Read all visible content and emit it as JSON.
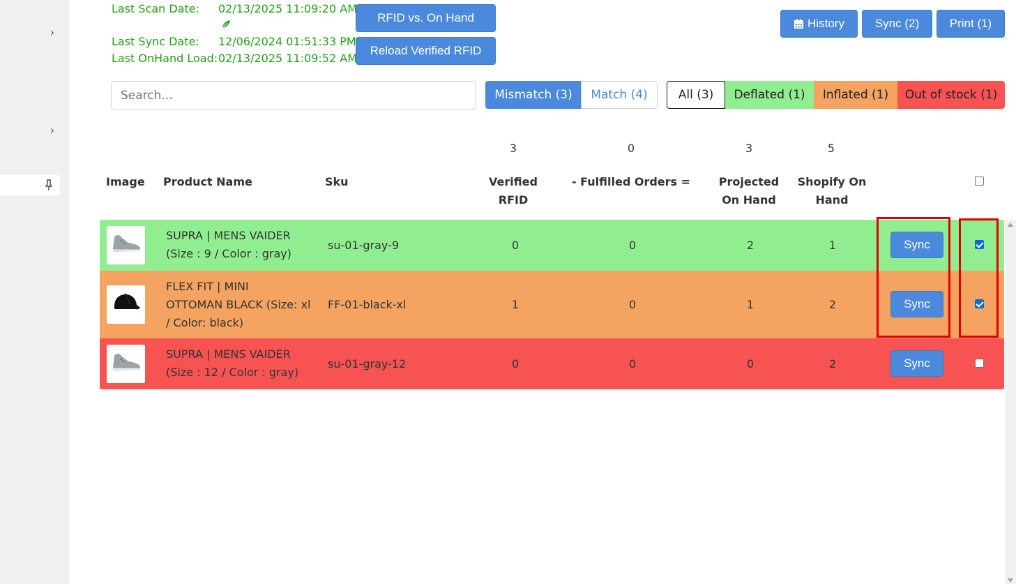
{
  "sidebar": {
    "chevron1": "›",
    "chevron2": "›"
  },
  "info": {
    "last_scan_label": "Last Scan Date:",
    "last_scan_value": "02/13/2025 11:09:20 AM",
    "last_sync_label": "Last Sync Date:",
    "last_sync_value": "12/06/2024 01:51:33 PM",
    "last_onhand_label": "Last OnHand Load:",
    "last_onhand_value": "02/13/2025 11:09:52 AM"
  },
  "actions": {
    "rfid_vs_onhand": "RFID vs. On Hand",
    "reload_verified": "Reload Verified RFID",
    "history": "History",
    "sync": "Sync (2)",
    "print": "Print (1)"
  },
  "search": {
    "placeholder": "Search..."
  },
  "match_toggle": {
    "mismatch": "Mismatch (3)",
    "match": "Match (4)"
  },
  "filters": {
    "all": "All (3)",
    "deflated": "Deflated (1)",
    "inflated": "Inflated (1)",
    "out_of_stock": "Out of stock (1)"
  },
  "colors": {
    "deflated": "#90ee90",
    "inflated": "#f4a460",
    "out_of_stock": "#f75353",
    "primary": "#4a89dc",
    "leaf": "#22a114"
  },
  "table": {
    "totals": {
      "verified": "3",
      "fulfilled": "0",
      "projected": "3",
      "shopify": "5"
    },
    "headers": {
      "image": "Image",
      "product_name": "Product Name",
      "sku": "Sku",
      "verified_1": "Verified",
      "verified_2": "RFID",
      "fulfilled": "- Fulfilled Orders =",
      "projected_1": "Projected",
      "projected_2": "On Hand",
      "shopify_1": "Shopify On",
      "shopify_2": "Hand"
    },
    "rows": [
      {
        "name_1": "SUPRA | MENS VAIDER",
        "name_2": "(Size : 9 / Color : gray)",
        "name_3": "",
        "sku": "su-01-gray-9",
        "verified": "0",
        "fulfilled": "0",
        "projected": "2",
        "shopify": "1",
        "sync": "Sync",
        "image_icon": "sneaker-icon"
      },
      {
        "name_1": "FLEX FIT | MINI",
        "name_2": "OTTOMAN BLACK (Size: xl",
        "name_3": "/ Color: black)",
        "sku": "FF-01-black-xl",
        "verified": "1",
        "fulfilled": "0",
        "projected": "1",
        "shopify": "2",
        "sync": "Sync",
        "image_icon": "cap-icon"
      },
      {
        "name_1": "SUPRA | MENS VAIDER",
        "name_2": "(Size : 12 / Color : gray)",
        "name_3": "",
        "sku": "su-01-gray-12",
        "verified": "0",
        "fulfilled": "0",
        "projected": "0",
        "shopify": "2",
        "sync": "Sync",
        "image_icon": "sneaker-icon"
      }
    ]
  }
}
